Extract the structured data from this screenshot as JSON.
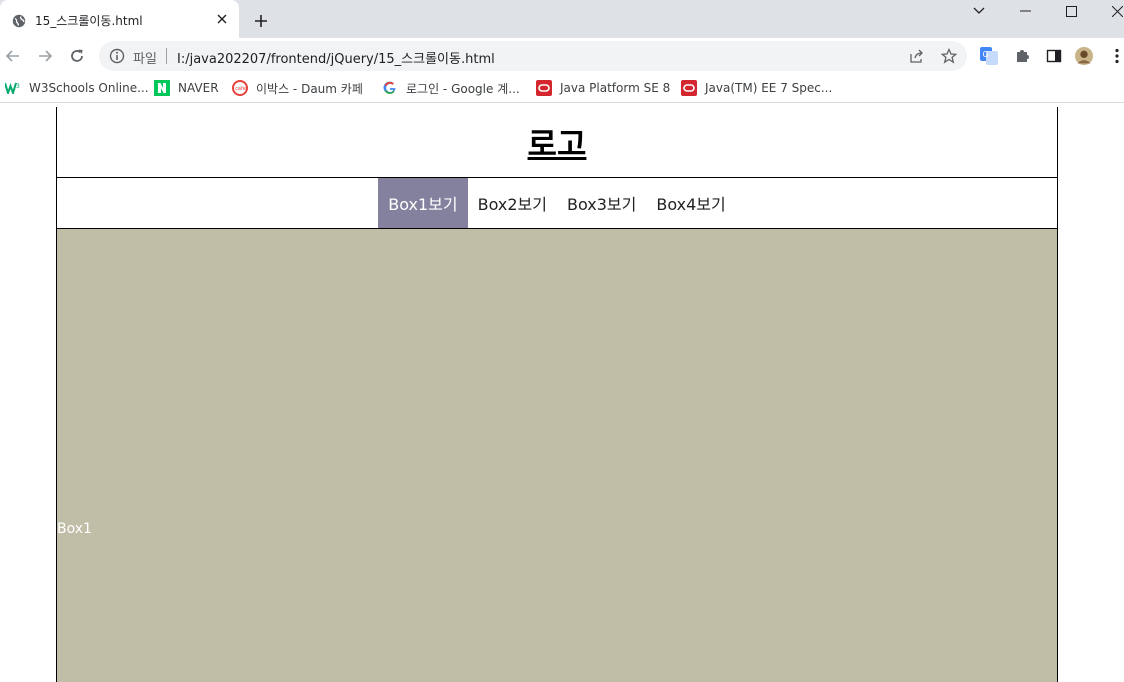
{
  "browser": {
    "tab": {
      "title": "15_스크롤이동.html"
    },
    "omnibox": {
      "scheme_label": "파일",
      "url": "I:/java202207/frontend/jQuery/15_스크롤이동.html"
    },
    "bookmarks": [
      {
        "label": "W3Schools Online...",
        "icon": "w3schools-icon"
      },
      {
        "label": "NAVER",
        "icon": "naver-icon"
      },
      {
        "label": "이박스 - Daum 카페",
        "icon": "daum-cafe-icon"
      },
      {
        "label": "로그인 - Google 계...",
        "icon": "google-icon"
      },
      {
        "label": "Java Platform SE 8",
        "icon": "oracle-icon"
      },
      {
        "label": "Java(TM) EE 7 Spec...",
        "icon": "oracle-icon"
      }
    ]
  },
  "page": {
    "logo": "로고",
    "menu": [
      {
        "label": "Box1보기",
        "active": true
      },
      {
        "label": "Box2보기",
        "active": false
      },
      {
        "label": "Box3보기",
        "active": false
      },
      {
        "label": "Box4보기",
        "active": false
      }
    ],
    "box1": {
      "label": "Box1"
    }
  },
  "colors": {
    "menu_active_bg": "#83819e",
    "box1_bg": "#c0bea6",
    "tabstrip_bg": "#dee1e6"
  }
}
